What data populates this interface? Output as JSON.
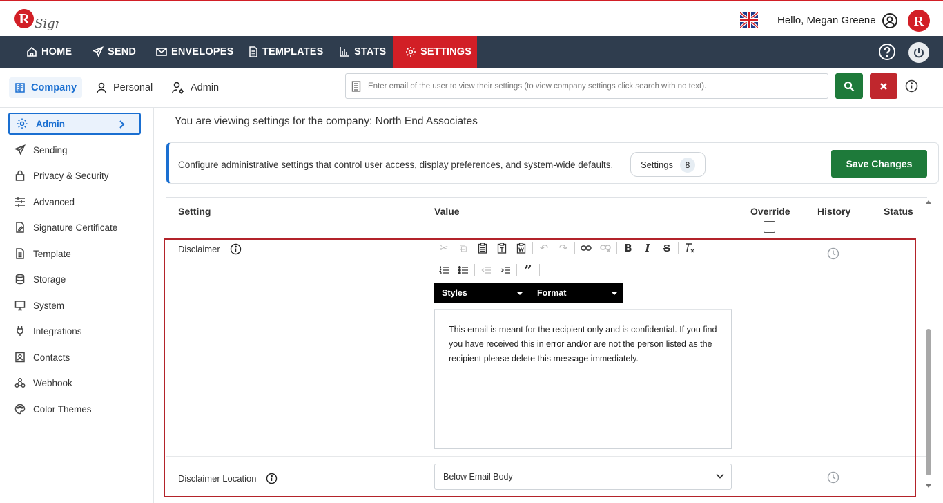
{
  "header": {
    "greeting": "Hello, Megan Greene",
    "logo_icon": "rsign-logo",
    "flag_icon": "uk-flag-icon",
    "brand_color": "#d21f26"
  },
  "nav": {
    "items": [
      {
        "label": "HOME",
        "icon": "home-icon"
      },
      {
        "label": "SEND",
        "icon": "send-icon"
      },
      {
        "label": "ENVELOPES",
        "icon": "envelope-icon"
      },
      {
        "label": "TEMPLATES",
        "icon": "document-icon"
      },
      {
        "label": "STATS",
        "icon": "bar-chart-icon"
      },
      {
        "label": "SETTINGS",
        "icon": "gear-icon"
      }
    ],
    "active": "SETTINGS",
    "bg_color": "#2f3d4e"
  },
  "subtabs": [
    {
      "label": "Company",
      "icon": "building-icon"
    },
    {
      "label": "Personal",
      "icon": "person-icon"
    },
    {
      "label": "Admin",
      "icon": "person-gear-icon"
    }
  ],
  "search": {
    "placeholder": "Enter email of the user to view their settings (to view company settings click search with no text)."
  },
  "sidebar": {
    "items": [
      {
        "label": "Admin",
        "icon": "gear-icon"
      },
      {
        "label": "Sending",
        "icon": "send-icon"
      },
      {
        "label": "Privacy & Security",
        "icon": "lock-icon"
      },
      {
        "label": "Advanced",
        "icon": "sliders-icon"
      },
      {
        "label": "Signature Certificate",
        "icon": "certificate-icon"
      },
      {
        "label": "Template",
        "icon": "document-icon"
      },
      {
        "label": "Storage",
        "icon": "database-icon"
      },
      {
        "label": "System",
        "icon": "monitor-icon"
      },
      {
        "label": "Integrations",
        "icon": "plug-icon"
      },
      {
        "label": "Contacts",
        "icon": "contact-icon"
      },
      {
        "label": "Webhook",
        "icon": "webhook-icon"
      },
      {
        "label": "Color Themes",
        "icon": "palette-icon"
      }
    ],
    "active": "Admin"
  },
  "main": {
    "company_line": "You are viewing settings for the company: North End Associates",
    "banner_text": "Configure administrative settings that control user access, display preferences, and system-wide defaults.",
    "settings_pill_label": "Settings",
    "settings_count": "8",
    "save_label": "Save Changes"
  },
  "table": {
    "headers": {
      "setting": "Setting",
      "value": "Value",
      "override": "Override",
      "history": "History",
      "status": "Status"
    },
    "rows": [
      {
        "label": "Disclaimer",
        "editor": {
          "styles_label": "Styles",
          "format_label": "Format",
          "content": "This email is meant for the recipient only and is confidential. If you find you have received this in error and/or are not the person listed as the recipient please delete this message immediately."
        }
      },
      {
        "label": "Disclaimer Location",
        "value": "Below Email Body"
      }
    ]
  }
}
